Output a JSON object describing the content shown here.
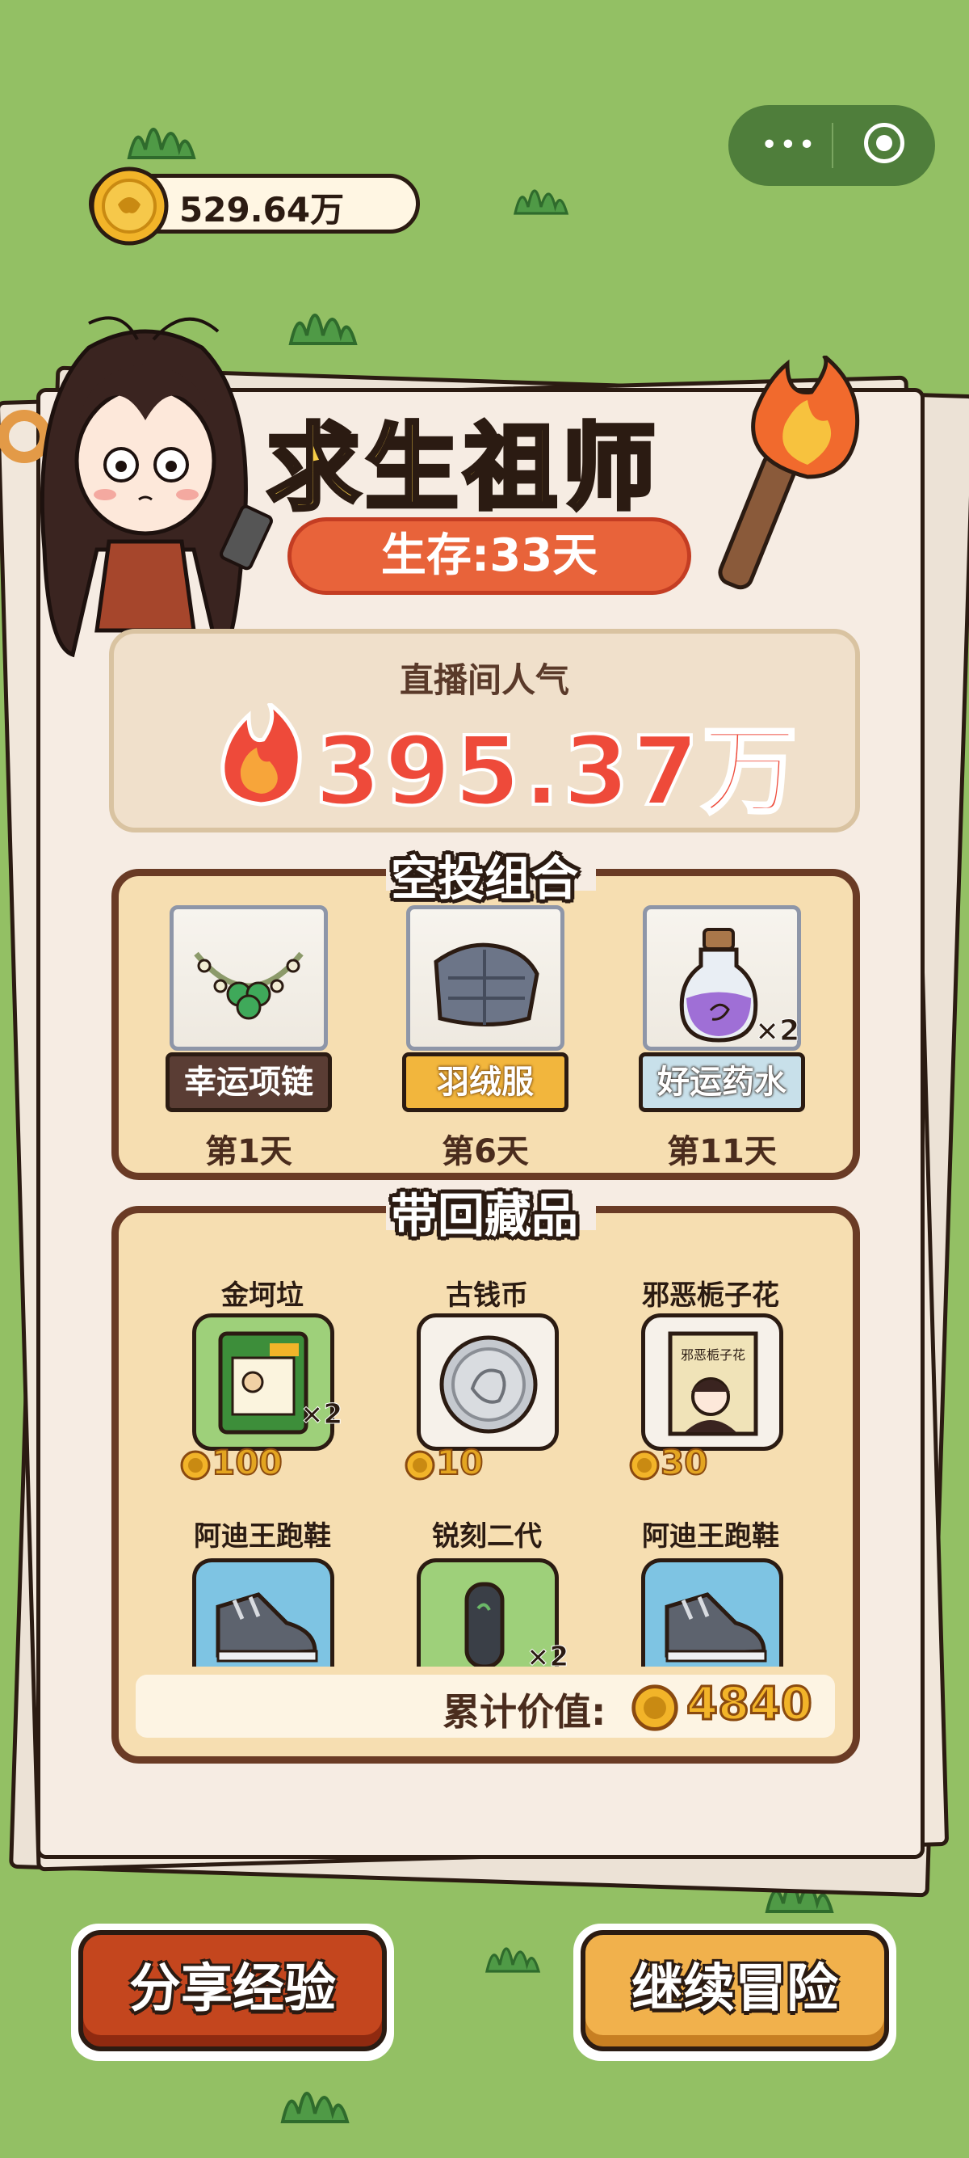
{
  "header": {
    "coins": "529.64万"
  },
  "card": {
    "title": "求生祖师",
    "days": "生存:33天",
    "popularity_label": "直播间人气",
    "popularity_value": "395.37万"
  },
  "airdrop": {
    "title": "空投组合",
    "items": [
      {
        "name": "幸运项链",
        "day": "第1天",
        "icon": "lucky-necklace-icon",
        "count": ""
      },
      {
        "name": "羽绒服",
        "day": "第6天",
        "icon": "down-jacket-icon",
        "count": ""
      },
      {
        "name": "好运药水",
        "day": "第11天",
        "icon": "luck-potion-icon",
        "count": "×2"
      }
    ]
  },
  "collection": {
    "title": "带回藏品",
    "items": [
      {
        "name": "金坷垃",
        "price": "100",
        "count": "×2",
        "icon": "fertilizer-bag-icon"
      },
      {
        "name": "古钱币",
        "price": "10",
        "count": "",
        "icon": "ancient-coin-icon"
      },
      {
        "name": "邪恶栀子花",
        "price": "30",
        "count": "",
        "icon": "evil-gardenia-book-icon"
      },
      {
        "name": "阿迪王跑鞋",
        "icon": "sneaker-icon"
      },
      {
        "name": "锐刻二代",
        "icon": "vape-pen-icon",
        "count": "×2"
      },
      {
        "name": "阿迪王跑鞋",
        "icon": "sneaker-icon"
      }
    ],
    "total_label": "累计价值:",
    "total_value": "4840"
  },
  "buttons": {
    "share": "分享经验",
    "continue": "继续冒险"
  },
  "colors": {
    "background": "#93c064",
    "accent_red": "#ee4a3a",
    "title_yellow": "#f6cd47",
    "share_button": "#c4461e",
    "continue_button": "#f1b14c"
  }
}
